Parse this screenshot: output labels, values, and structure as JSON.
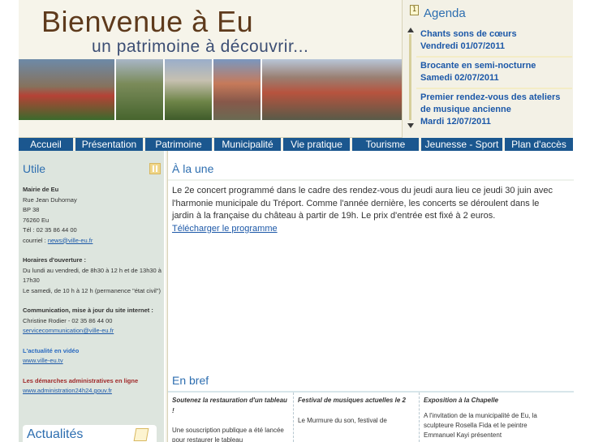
{
  "header": {
    "title": "Bienvenue à Eu",
    "subtitle": "un patrimoine à découvrir..."
  },
  "agenda": {
    "title": "Agenda",
    "icon": "calendar-icon",
    "items": [
      {
        "title": "Chants sons de cœurs",
        "date": "Vendredi 01/07/2011"
      },
      {
        "title": "Brocante en semi-nocturne",
        "date": "Samedi 02/07/2011"
      },
      {
        "title": "Premier rendez-vous des ateliers de musique ancienne",
        "date": "Mardi 12/07/2011"
      }
    ]
  },
  "nav": {
    "items": [
      "Accueil",
      "Présentation",
      "Patrimoine",
      "Municipalité",
      "Vie pratique",
      "Tourisme",
      "Jeunesse - Sport",
      "Plan d'accès"
    ]
  },
  "utile": {
    "title": "Utile",
    "mairie": {
      "name": "Mairie de Eu",
      "street": "Rue Jean Duhornay",
      "bp": "BP 38",
      "city": "76260 Eu",
      "tel": "Tél : 02 35 86 44 00",
      "email_label": "courriel : ",
      "email": "news@ville-eu.fr"
    },
    "horaires": {
      "title": "Horaires d'ouverture :",
      "line1": "Du lundi au vendredi, de 8h30 à 12 h et de 13h30 à 17h30",
      "line2": "Le samedi, de 10 h à 12 h (permanence \"état civil\")"
    },
    "communication": {
      "title": "Communication, mise à jour du site internet :",
      "contact": "Christine Rodier - 02 35 86 44 00",
      "email": "servicecommunication@ville-eu.fr"
    },
    "video": {
      "title": "L'actualité en vidéo",
      "link": "www.ville-eu.tv"
    },
    "demarches": {
      "title": "Les démarches administratives en ligne",
      "link": "www.administration24h24.gouv.fr"
    }
  },
  "actualites": {
    "title": "Actualités"
  },
  "une": {
    "title": "À la une",
    "text": "Le 2e concert programmé dans le cadre des rendez-vous du jeudi aura lieu ce jeudi 30 juin avec l'harmonie municipale du Tréport. Comme l'année dernière, les concerts se déroulent dans le jardin à la française du château à partir de 19h. Le prix d'entrée est fixé à 2 euros.",
    "link": "Télécharger le programme"
  },
  "enbref": {
    "title": "En bref",
    "items": [
      {
        "title": "Soutenez la restauration d'un tableau !",
        "text": "Une souscription publique a été lancée pour restaurer le tableau"
      },
      {
        "title": "Festival de musiques actuelles le 2",
        "text": "Le Murmure du son, festival de"
      },
      {
        "title": "Exposition à la Chapelle",
        "text": "A l'invitation de la municipalité de Eu, la sculpteure Rosella Fida et le peintre Emmanuel Kayi présentent"
      }
    ]
  }
}
